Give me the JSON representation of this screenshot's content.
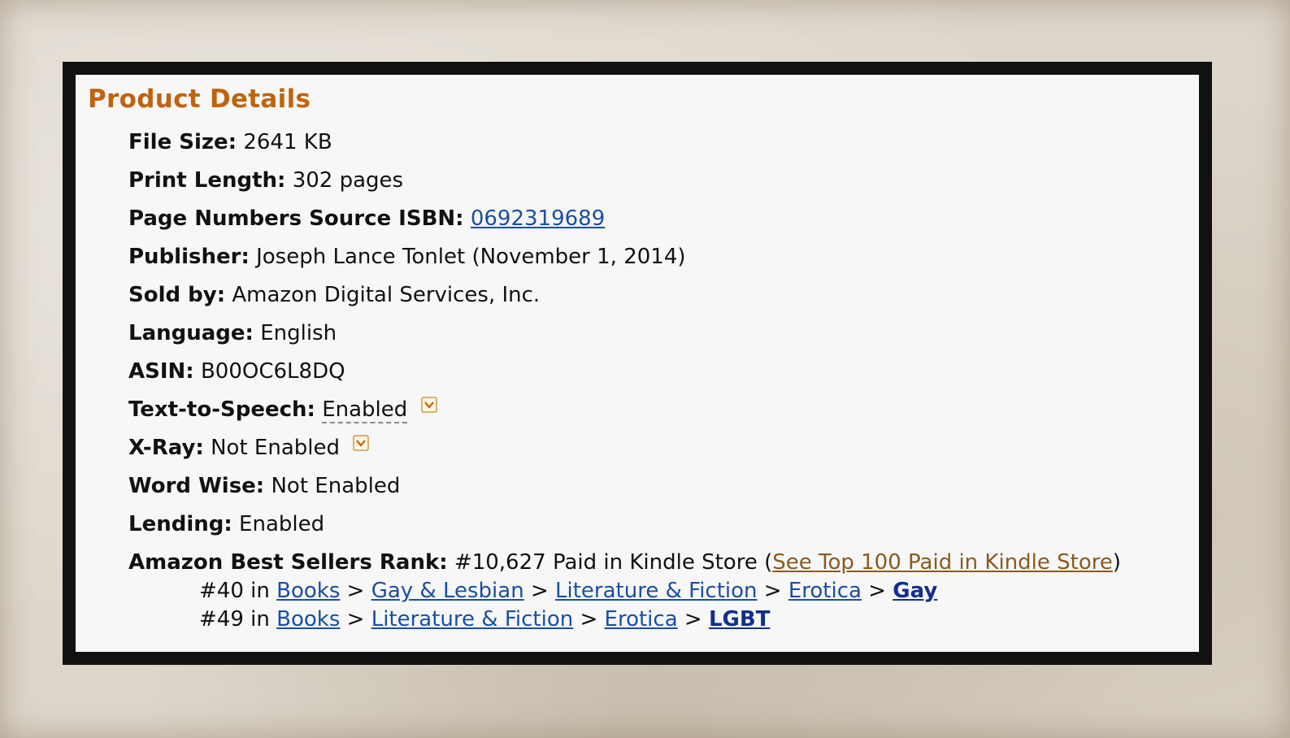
{
  "title": "Product Details",
  "fields": {
    "file_size": {
      "label": "File Size:",
      "value": "2641 KB"
    },
    "print_length": {
      "label": "Print Length:",
      "value": "302 pages"
    },
    "isbn": {
      "label": "Page Numbers Source ISBN:",
      "value": "0692319689"
    },
    "publisher": {
      "label": "Publisher:",
      "value": "Joseph Lance Tonlet (November 1, 2014)"
    },
    "sold_by": {
      "label": "Sold by:",
      "value": "Amazon Digital Services, Inc."
    },
    "language": {
      "label": "Language:",
      "value": "English"
    },
    "asin": {
      "label": "ASIN:",
      "value": "B00OC6L8DQ"
    },
    "tts": {
      "label": "Text-to-Speech:",
      "value": "Enabled",
      "icon": "chevron-down-icon"
    },
    "xray": {
      "label": "X-Ray:",
      "value": "Not Enabled",
      "icon": "chevron-down-icon"
    },
    "word_wise": {
      "label": "Word Wise:",
      "value": "Not Enabled"
    },
    "lending": {
      "label": "Lending:",
      "value": "Enabled"
    }
  },
  "rank": {
    "label": "Amazon Best Sellers Rank:",
    "value": "#10,627 Paid in Kindle Store",
    "open_paren": "(",
    "top100_link": "See Top 100 Paid in Kindle Store",
    "close_paren": ")",
    "sub": [
      {
        "prefix": "#40 in",
        "c1": "Books",
        "c2": "Gay & Lesbian",
        "c3": "Literature & Fiction",
        "c4": "Erotica",
        "c5": "Gay"
      },
      {
        "prefix": "#49 in",
        "c1": "Books",
        "c2": "Literature & Fiction",
        "c3": "Erotica",
        "c4": "LGBT"
      }
    ],
    "separator": ">"
  },
  "colors": {
    "title": "#c0630f",
    "link": "#1a4fa0",
    "link_orange": "#8a5a1e",
    "frame": "#111111",
    "panel": "#f7f7f7"
  }
}
